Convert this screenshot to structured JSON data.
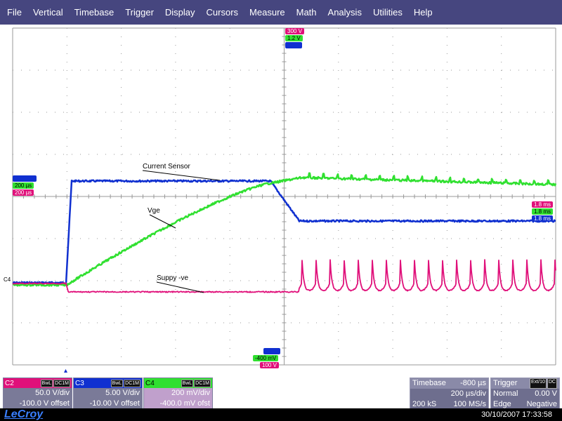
{
  "menu": [
    "File",
    "Vertical",
    "Timebase",
    "Trigger",
    "Display",
    "Cursors",
    "Measure",
    "Math",
    "Analysis",
    "Utilities",
    "Help"
  ],
  "colors": {
    "menu_bg": "#46467f",
    "grid": "#9a9a9a",
    "c2": "#e0107a",
    "c3": "#1030d0",
    "c4": "#30e030"
  },
  "trace_labels": {
    "current_sensor": "Current Sensor",
    "vge": "Vge",
    "supply": "Suppy -ve"
  },
  "ch_marker": "C4",
  "tags": {
    "top_c2": "300 V",
    "top_c4": "1.2 V",
    "top_c3": "",
    "left_c3": "",
    "left_c4": "200 µs",
    "left_c2": "200 µs",
    "right_c2": "1.8 ms",
    "right_c4": "1.8 ms",
    "right_c3": "1.8 ms",
    "bot_c3": "",
    "bot_c4": "-400 mV",
    "bot_c2": "100 V"
  },
  "channels": [
    {
      "id": "C2",
      "color": "#e0107a",
      "badges": [
        "BwL",
        "DC1M"
      ],
      "vdiv": "50.0 V/div",
      "offset": "-100.0 V offset"
    },
    {
      "id": "C3",
      "color": "#1030d0",
      "badges": [
        "BwL",
        "DC1M"
      ],
      "vdiv": "5.00 V/div",
      "offset": "-10.00 V offset"
    },
    {
      "id": "C4",
      "color": "#30e030",
      "badges": [
        "BwL",
        "DC1M"
      ],
      "vdiv": "200 mV/div",
      "offset": "-400.0 mV ofst"
    }
  ],
  "timebase": {
    "label": "Timebase",
    "delay": "-800 µs",
    "tdiv": "200 µs/div",
    "samples": "200 kS",
    "rate": "100 MS/s"
  },
  "trigger": {
    "label": "Trigger",
    "source": "Ext/10",
    "coupling": "DC",
    "mode": "Normal",
    "level": "0.00 V",
    "type": "Edge",
    "slope": "Negative"
  },
  "footer": {
    "logo": "LeCroy",
    "datetime": "30/10/2007 17:33:58"
  }
}
